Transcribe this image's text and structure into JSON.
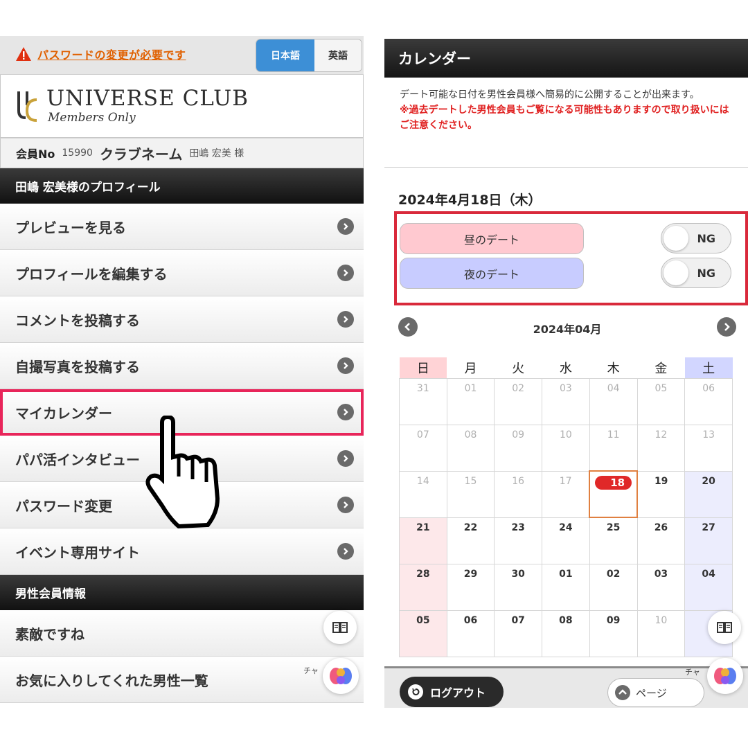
{
  "left": {
    "warning_text": "パスワードの変更が必要です",
    "lang_jp": "日本語",
    "lang_en": "英語",
    "logo_title": "UNIVERSE CLUB",
    "logo_sub": "Members Only",
    "member_no_label": "会員No",
    "member_no": "15990",
    "club_name_label": "クラブネーム",
    "club_name": "田嶋 宏美 様",
    "profile_section": "田嶋 宏美様のプロフィール",
    "menu": [
      {
        "label": "プレビューを見る"
      },
      {
        "label": "プロフィールを編集する"
      },
      {
        "label": "コメントを投稿する"
      },
      {
        "label": "自撮写真を投稿する"
      },
      {
        "label": "マイカレンダー"
      },
      {
        "label": "パパ活インタビュー"
      },
      {
        "label": "パスワード変更"
      },
      {
        "label": "イベント専用サイト"
      }
    ],
    "male_section": "男性会員情報",
    "male_menu": [
      {
        "label": "素敵ですね"
      },
      {
        "label": "お気に入りしてくれた男性一覧"
      }
    ],
    "chat_label": "チャ"
  },
  "right": {
    "header": "カレンダー",
    "desc": "デート可能な日付を男性会員様へ簡易的に公開することが出来ます。",
    "desc_warning": "※過去デートした男性会員もご覧になる可能性もありますので取り扱いにはご注意ください。",
    "selected_date": "2024年4月18日（木）",
    "day_date_label": "昼のデート",
    "night_date_label": "夜のデート",
    "day_status": "NG",
    "night_status": "NG",
    "month_title": "2024年04月",
    "weekdays": [
      "日",
      "月",
      "火",
      "水",
      "木",
      "金",
      "土"
    ],
    "weeks": [
      [
        "31",
        "01",
        "02",
        "03",
        "04",
        "05",
        "06"
      ],
      [
        "07",
        "08",
        "09",
        "10",
        "11",
        "12",
        "13"
      ],
      [
        "14",
        "15",
        "16",
        "17",
        "18",
        "19",
        "20"
      ],
      [
        "21",
        "22",
        "23",
        "24",
        "25",
        "26",
        "27"
      ],
      [
        "28",
        "29",
        "30",
        "01",
        "02",
        "03",
        "04"
      ],
      [
        "05",
        "06",
        "07",
        "08",
        "09",
        "10",
        ""
      ]
    ],
    "today": "18",
    "logout_label": "ログアウト",
    "pagetop_label": "ページ",
    "chat_label": "チャ"
  },
  "colors": {
    "accent_warning": "#e06000",
    "lang_active": "#3d8fd6",
    "highlight_border": "#e8255a",
    "toggle_box_border": "#d9293b",
    "day_pill": "#ffc9d0",
    "night_pill": "#c8ccff",
    "today_badge": "#e02828"
  }
}
